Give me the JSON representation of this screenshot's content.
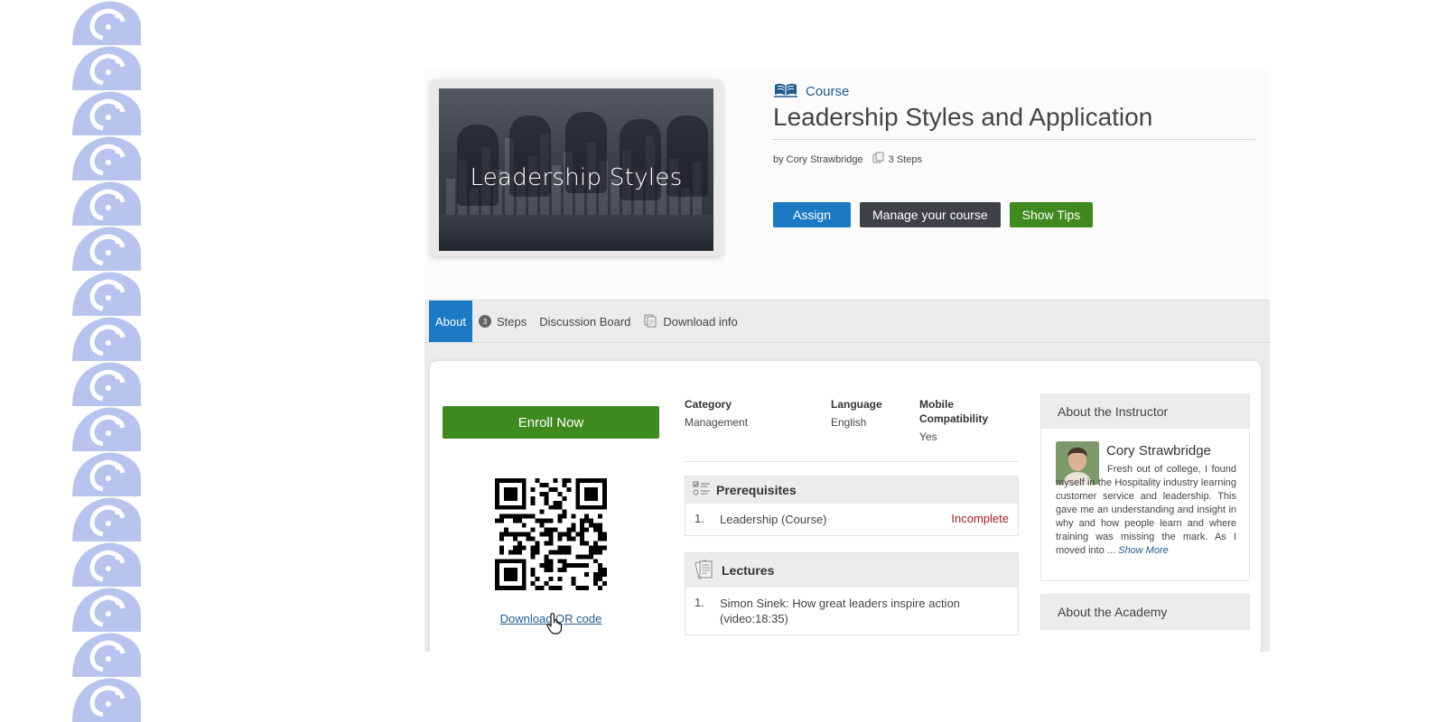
{
  "course": {
    "type_label": "Course",
    "title": "Leadership Styles and Application",
    "thumbnail_title": "Leadership Styles",
    "author": "by Cory Strawbridge",
    "steps": "3 Steps"
  },
  "actions": {
    "assign": "Assign",
    "manage": "Manage your course",
    "tips": "Show Tips"
  },
  "tabs": [
    {
      "label": "About",
      "active": true
    },
    {
      "label": "Steps",
      "count": "3"
    },
    {
      "label": "Discussion Board"
    },
    {
      "label": "Download info"
    }
  ],
  "enroll": {
    "label": "Enroll Now"
  },
  "qr": {
    "link_label": "Download QR code"
  },
  "info": {
    "category_label": "Category",
    "category_value": "Management",
    "language_label": "Language",
    "language_value": "English",
    "mobile_label": "Mobile Compatibility",
    "mobile_value": "Yes"
  },
  "prerequisites": {
    "title": "Prerequisites",
    "items": [
      {
        "num": "1.",
        "name": "Leadership (Course)",
        "status": "Incomplete"
      }
    ]
  },
  "lectures": {
    "title": "Lectures",
    "items": [
      {
        "num": "1.",
        "name": "Simon Sinek: How great leaders inspire action (video:18:35)"
      }
    ]
  },
  "instructor": {
    "section_title": "About the Instructor",
    "name": "Cory Strawbridge",
    "bio": "Fresh out of college, I found myself in the Hospitality industry learning customer service and leadership. This gave me an understanding and insight in why and how people learn and where training was missing the mark. As I moved into ...",
    "show_more": "Show More"
  },
  "academy": {
    "section_title": "About the Academy"
  },
  "colors": {
    "primary": "#1c7ac4",
    "success": "#3f8a1f",
    "dark": "#3e4247",
    "danger": "#a11f1f",
    "link": "#1f5b8f"
  }
}
